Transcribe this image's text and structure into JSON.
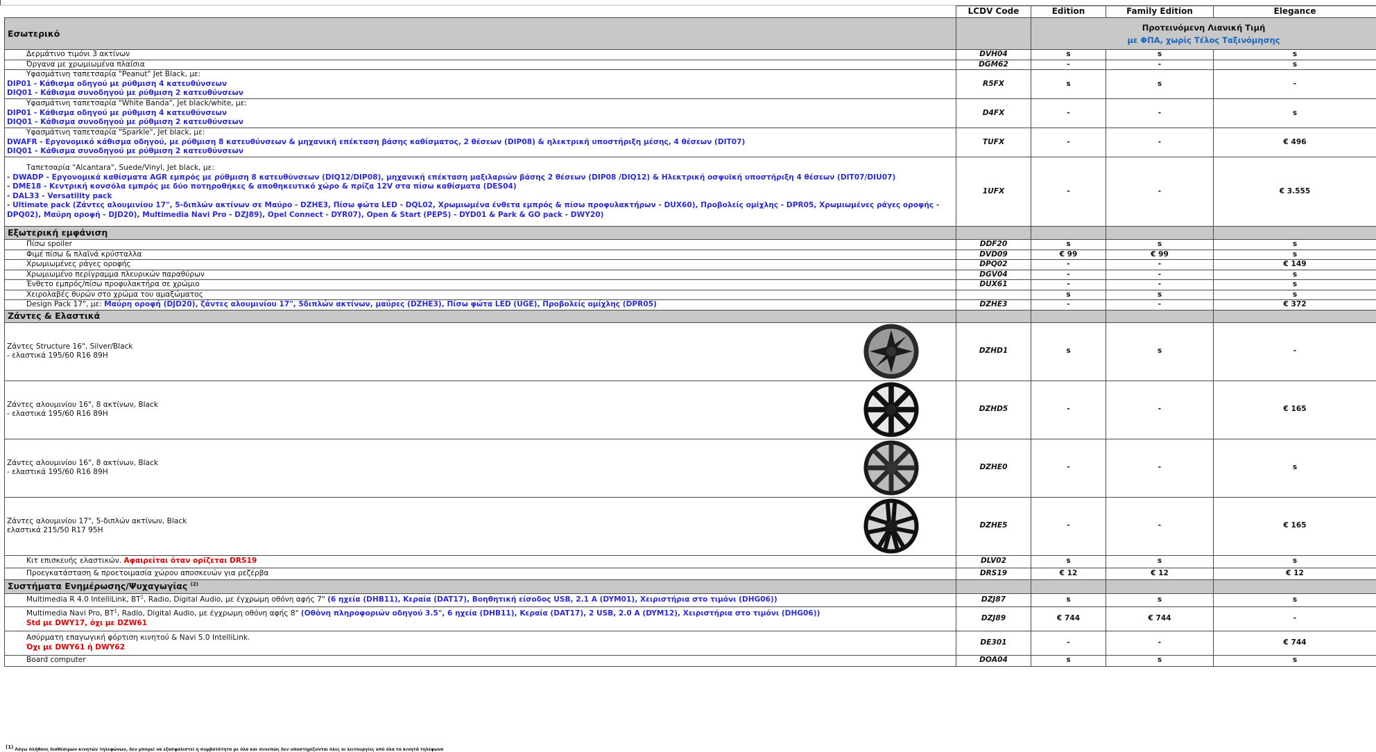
{
  "header": {
    "lcdv": "LCDV Code",
    "edition": "Edition",
    "family": "Family Edition",
    "elegance": "Elegance"
  },
  "price_note": {
    "line1": "Προτεινόμενη Λιανική Τιμή",
    "line2": "με ΦΠΑ, χωρίς Τέλος Ταξινόμησης"
  },
  "sections": {
    "interior": "Εσωτερικό",
    "exterior": "Εξωτερική εμφάνιση",
    "wheels": "Ζάντες & Ελαστικά",
    "infotainment": "Συστήματα Ενημέρωσης/Ψυχαγωγίας",
    "infotainment_sup": "(2)"
  },
  "interior": [
    {
      "desc": "Δερμάτινο τιμόνι 3 ακτίνων",
      "code": "DVH04",
      "v": [
        "s",
        "s",
        "s"
      ]
    },
    {
      "desc": "Όργανα με χρωμιωμένα πλαίσια",
      "code": "DGM62",
      "v": [
        "-",
        "-",
        "s"
      ]
    },
    {
      "desc": "Υφασμάτινη ταπετσαρία \"Peanut\" Jet Black, με:",
      "lines": [
        "DIP01 - Κάθισμα οδηγού με ρύθμιση 4 κατευθύνσεων",
        "DIQ01 - Κάθισμα συνοδηγού με ρύθμιση 2 κατευθύνσεων"
      ],
      "code": "R5FX",
      "v": [
        "s",
        "s",
        "-"
      ]
    },
    {
      "desc": "Υφασμάτινη ταπετσαρία \"White Banda\", Jet black/white, με:",
      "lines": [
        "DIP01 - Κάθισμα οδηγού με ρύθμιση 4 κατευθύνσεων",
        "DIQ01 - Κάθισμα συνοδηγού με ρύθμιση 2 κατευθύνσεων"
      ],
      "code": "D4FX",
      "v": [
        "-",
        "-",
        "s"
      ]
    },
    {
      "desc": "Υφασμάτινη ταπετσαρία \"Sparkle\", Jet black, με:",
      "lines": [
        "DWAFR - Εργονομικό κάθισμα οδηγού, με ρύθμιση 8 κατευθύνσεων & μηχανική επέκταση βάσης καθίσματος, 2 θέσεων (DIP08) & ηλεκτρική υποστήριξη μέσης, 4 θέσεων (DIT07)",
        "DIQ01 - Κάθισμα συνοδηγού με ρύθμιση 2 κατευθύνσεων"
      ],
      "code": "TUFX",
      "v": [
        "-",
        "-",
        "€ 496"
      ]
    },
    {
      "desc": "Ταπετσαρία \"Alcantara\", Suede/Vinyl, Jet black, με:",
      "lines": [
        "- DWADP - Εργονομικά καθίσματα AGR εμπρός με ρύθμιση 8 κατευθύνσεων (DIQ12/DIP08), μηχανική επέκταση μαξιλαριών βάσης 2 θέσεων (DIP08 /DIQ12) & Ηλεκτρική οσφυϊκή υποστήριξη 4 θέσεων (DIT07/DIU07)",
        "- DME18 - Κεντρική κονσόλα εμπρός με δύο ποτηροθήκες & αποθηκευτικό χώρο & πρίζα 12V στα πίσω καθίσματα (DES04)",
        "- DAL33 - Versatility pack",
        "- Ultimate pack (Ζάντες αλουμινίου 17\", 5-διπλών ακτίνων σε Μαύρο - DZHE3, Πίσω φώτα LED - DQL02, Χρωμιωμένα ένθετα εμπρός & πίσω προφυλακτήρων - DUX60), Προβολείς ομίχλης  - DPR05, Χρωμιωμένες ράγες οροφής -",
        "DPQ02), Μαύρη οροφή - DJD20), Multimedia Navi Pro  - DZJ89), Opel Connect - DYR07), Open & Start (PEPS) - DYD01 & Park & GO pack - DWY20)"
      ],
      "code": "1UFX",
      "v": [
        "-",
        "-",
        "€ 3.555"
      ]
    }
  ],
  "exterior": [
    {
      "desc": "Πίσω spoiler",
      "code": "DDF20",
      "v": [
        "s",
        "s",
        "s"
      ]
    },
    {
      "desc": "Φιμέ πίσω & πλαϊνά κρύσταλλα",
      "code": "DVD09",
      "v": [
        "€ 99",
        "€ 99",
        "s"
      ]
    },
    {
      "desc": "Χρωμιωμένες ράγες οροφής",
      "code": "DPQ02",
      "v": [
        "-",
        "-",
        "€ 149"
      ]
    },
    {
      "desc": "Χρωμιωμένο περίγραμμα πλευρικών παραθύρων",
      "code": "DGV04",
      "v": [
        "-",
        "-",
        "s"
      ]
    },
    {
      "desc": "Ένθετο εμπρός/πίσω προφυλακτήρα σε χρώμιο",
      "code": "DUX61",
      "v": [
        "-",
        "-",
        "s"
      ]
    },
    {
      "desc": "Χειρολαβές θυρών στο χρώμα του αμαξώματος",
      "code": "",
      "v": [
        "s",
        "s",
        "s"
      ]
    },
    {
      "desc": "Design Pack 17\", με: ",
      "blue": "Μαύρη οροφή (DJD20), ζάντες αλουμινίου 17\", 5διπλών ακτίνων, μαύρες (DZHE3), Πίσω φώτα LED (UGE), Προβολείς ομίχλης (DPR05)",
      "code": "DZHE3",
      "v": [
        "-",
        "-",
        "€ 372"
      ]
    }
  ],
  "wheels": [
    {
      "l1": "Ζάντες Structure 16\", Silver/Black",
      "l2": "- ελαστικά 195/60 R16 89H",
      "code": "DZHD1",
      "v": [
        "s",
        "s",
        "-"
      ],
      "icon": "wheel-cover-icon"
    },
    {
      "l1": "Ζάντες αλουμινίου 16\", 8 ακτίνων, Black",
      "l2": "- ελαστικά 195/60 R16 89H",
      "code": "DZHD5",
      "v": [
        "-",
        "-",
        "€ 165"
      ],
      "icon": "alloy-wheel-icon"
    },
    {
      "l1": "Ζάντες αλουμινίου 16\", 8 ακτίνων, Black",
      "l2": "- ελαστικά 195/60 R16 89H",
      "code": "DZHE0",
      "v": [
        "-",
        "-",
        "s"
      ],
      "icon": "alloy-wheel-icon"
    },
    {
      "l1": "Ζάντες αλουμινίου 17\", 5-διπλών ακτίνων, Black",
      "l2": "ελαστικά 215/50 R17 95H",
      "code": "DZHE5",
      "v": [
        "-",
        "-",
        "€ 165"
      ],
      "icon": "alloy-wheel-icon"
    }
  ],
  "tyres": [
    {
      "desc": "Κιτ επισκευής ελαστικών. ",
      "red": "Αφαιρείται όταν ορίζεται DRS19",
      "code": "DLV02",
      "v": [
        "s",
        "s",
        "s"
      ]
    },
    {
      "desc": "Προεγκατάσταση & προετοιμασία χώρου αποσκευών για ρεζέρβα",
      "red": "",
      "code": "DRS19",
      "v": [
        "€ 12",
        "€ 12",
        "€ 12"
      ]
    }
  ],
  "info": [
    {
      "desc": "Multimedia R 4.0 IntelliLink, BT",
      "sup": "1",
      "desc2": ", Radio, Digital Audio, με έγχρωμη οθόνη αφής 7\" ",
      "blue": "(6 ηχεία (DHB11), Κεραία (DAT17), Βοηθητική είσοδος USB, 2.1 A (DYM01), Χειριστήρια στο τιμόνι (DHG06))",
      "red": "",
      "code": "DZJ87",
      "v": [
        "s",
        "s",
        "s"
      ]
    },
    {
      "desc": "Multimedia Navi Pro, BT",
      "sup": "1",
      "desc2": ", Radio, Digital Audio, με έγχρωμη οθόνη αφής 8\" ",
      "blue": "(Οθόνη πληροφοριών οδηγού 3.5\", 6 ηχεία (DHB11), Κεραία (DAT17), 2 USB, 2.0 A (DYM12), Χειριστήρια στο τιμόνι (DHG06))",
      "red": "Std με DWY17, όχι με DZW61",
      "code": "DZJ89",
      "v": [
        "€ 744",
        "€ 744",
        "-"
      ]
    },
    {
      "desc": "Ασύρματη επαγωγική φόρτιση κινητού & Navi 5.0 IntelliLink.",
      "sup": "",
      "desc2": "",
      "blue": "",
      "red": "Όχι με DWY61 ή DWY62",
      "code": "DE301",
      "v": [
        "-",
        "-",
        "€ 744"
      ]
    },
    {
      "desc": "Board computer",
      "sup": "",
      "desc2": "",
      "blue": "",
      "red": "",
      "code": "DOA04",
      "v": [
        "s",
        "s",
        "s"
      ]
    }
  ],
  "footnote": {
    "mark": "(1)",
    "text": "Λόγω πλήθους διαθέσιμων κινητών τηλεφώνων, δεν μπορεί να εξασφαλιστεί η συμβατότητα με όλα και συνεπώς δεν υποστηρίζονται όλες οι λειτουργίες από όλα τα κινητά τηλέφωνα"
  }
}
